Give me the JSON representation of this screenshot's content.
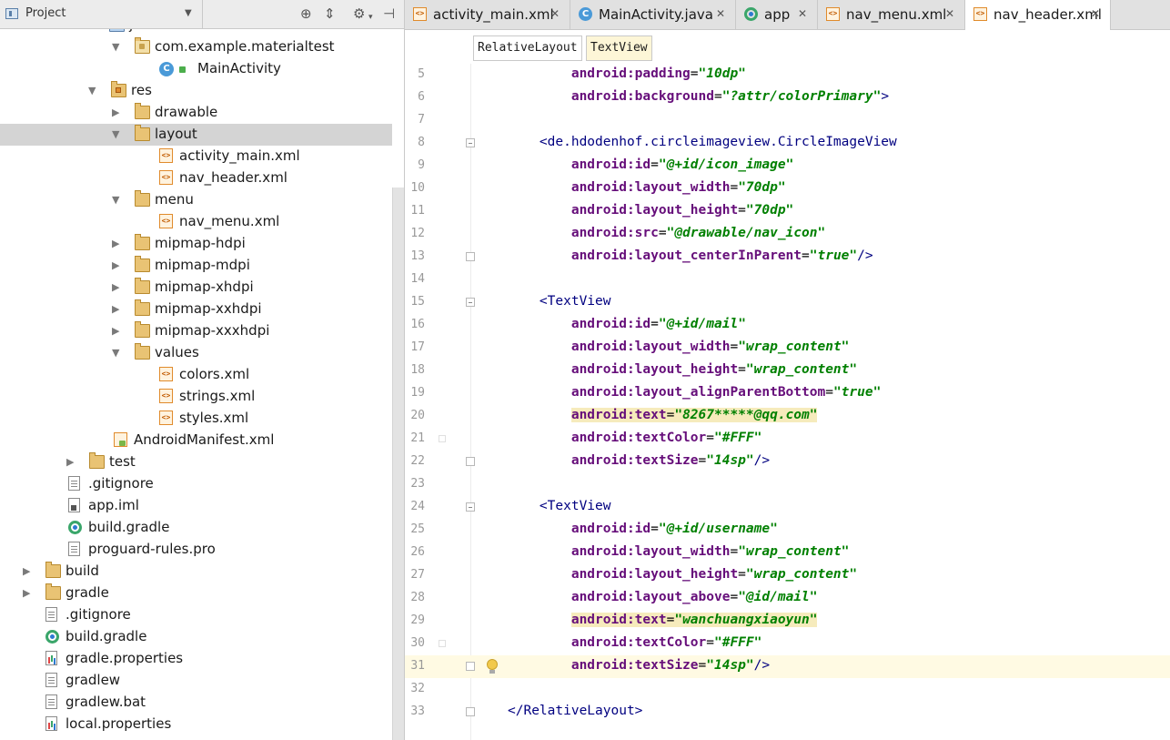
{
  "project_panel": {
    "title": "Project",
    "tools": [
      "target-icon",
      "collapse-icon",
      "gear-icon",
      "hide-icon"
    ],
    "tree": [
      {
        "label": "java",
        "icon": "folder-src",
        "indent": 120,
        "arrow": "none"
      },
      {
        "label": "com.example.materialtest",
        "icon": "folder-package",
        "indent": 148,
        "arrow": "down"
      },
      {
        "label": "MainActivity",
        "icon": "class",
        "indent": 175,
        "arrow": "none",
        "badge": true
      },
      {
        "label": "res",
        "icon": "folder-res",
        "indent": 122,
        "arrow": "down"
      },
      {
        "label": "drawable",
        "icon": "folder",
        "indent": 148,
        "arrow": "right"
      },
      {
        "label": "layout",
        "icon": "folder",
        "indent": 148,
        "arrow": "down",
        "selected": true
      },
      {
        "label": "activity_main.xml",
        "icon": "xml",
        "indent": 175,
        "arrow": "none"
      },
      {
        "label": "nav_header.xml",
        "icon": "xml",
        "indent": 175,
        "arrow": "none"
      },
      {
        "label": "menu",
        "icon": "folder",
        "indent": 148,
        "arrow": "down"
      },
      {
        "label": "nav_menu.xml",
        "icon": "xml",
        "indent": 175,
        "arrow": "none"
      },
      {
        "label": "mipmap-hdpi",
        "icon": "folder",
        "indent": 148,
        "arrow": "right"
      },
      {
        "label": "mipmap-mdpi",
        "icon": "folder",
        "indent": 148,
        "arrow": "right"
      },
      {
        "label": "mipmap-xhdpi",
        "icon": "folder",
        "indent": 148,
        "arrow": "right"
      },
      {
        "label": "mipmap-xxhdpi",
        "icon": "folder",
        "indent": 148,
        "arrow": "right"
      },
      {
        "label": "mipmap-xxxhdpi",
        "icon": "folder",
        "indent": 148,
        "arrow": "right"
      },
      {
        "label": "values",
        "icon": "folder",
        "indent": 148,
        "arrow": "down"
      },
      {
        "label": "colors.xml",
        "icon": "xml",
        "indent": 175,
        "arrow": "none"
      },
      {
        "label": "strings.xml",
        "icon": "xml",
        "indent": 175,
        "arrow": "none"
      },
      {
        "label": "styles.xml",
        "icon": "xml",
        "indent": 175,
        "arrow": "none"
      },
      {
        "label": "AndroidManifest.xml",
        "icon": "manifest",
        "indent": 125,
        "arrow": "none"
      },
      {
        "label": "test",
        "icon": "folder",
        "indent": 98,
        "arrow": "right"
      },
      {
        "label": ".gitignore",
        "icon": "text",
        "indent": 75,
        "arrow": "none"
      },
      {
        "label": "app.iml",
        "icon": "iml",
        "indent": 75,
        "arrow": "none"
      },
      {
        "label": "build.gradle",
        "icon": "gradle",
        "indent": 75,
        "arrow": "none"
      },
      {
        "label": "proguard-rules.pro",
        "icon": "text",
        "indent": 75,
        "arrow": "none"
      },
      {
        "label": "build",
        "icon": "folder",
        "indent": 50,
        "arrow": "right"
      },
      {
        "label": "gradle",
        "icon": "folder",
        "indent": 50,
        "arrow": "right"
      },
      {
        "label": ".gitignore",
        "icon": "text",
        "indent": 50,
        "arrow": "none"
      },
      {
        "label": "build.gradle",
        "icon": "gradle",
        "indent": 50,
        "arrow": "none"
      },
      {
        "label": "gradle.properties",
        "icon": "props",
        "indent": 50,
        "arrow": "none"
      },
      {
        "label": "gradlew",
        "icon": "text",
        "indent": 50,
        "arrow": "none"
      },
      {
        "label": "gradlew.bat",
        "icon": "text",
        "indent": 50,
        "arrow": "none"
      },
      {
        "label": "local.properties",
        "icon": "props",
        "indent": 50,
        "arrow": "none"
      }
    ]
  },
  "editor": {
    "tabs": [
      {
        "label": "activity_main.xml",
        "icon": "xml",
        "active": false
      },
      {
        "label": "MainActivity.java",
        "icon": "class",
        "active": false
      },
      {
        "label": "app",
        "icon": "gradle",
        "active": false
      },
      {
        "label": "nav_menu.xml",
        "icon": "xml",
        "active": false
      },
      {
        "label": "nav_header.xml",
        "icon": "xml",
        "active": true
      }
    ],
    "close_glyph": "✕",
    "breadcrumbs": [
      "RelativeLayout",
      "TextView"
    ],
    "current_line": 31,
    "lines": [
      {
        "n": 5,
        "parts": [
          [
            "        ",
            ""
          ],
          [
            "android:padding",
            "attr"
          ],
          [
            "=",
            ""
          ],
          [
            "\"10dp\"",
            "val"
          ]
        ]
      },
      {
        "n": 6,
        "parts": [
          [
            "        ",
            ""
          ],
          [
            "android:background",
            "attr"
          ],
          [
            "=",
            ""
          ],
          [
            "\"?attr/colorPrimary\"",
            "val"
          ],
          [
            ">",
            "tag"
          ]
        ]
      },
      {
        "n": 7,
        "parts": []
      },
      {
        "n": 8,
        "fold": "start",
        "parts": [
          [
            "    ",
            ""
          ],
          [
            "<de.hdodenhof.circleimageview.CircleImageView",
            "tag"
          ]
        ]
      },
      {
        "n": 9,
        "parts": [
          [
            "        ",
            ""
          ],
          [
            "android:id",
            "attr"
          ],
          [
            "=",
            ""
          ],
          [
            "\"@+id/icon_image\"",
            "val"
          ]
        ]
      },
      {
        "n": 10,
        "parts": [
          [
            "        ",
            ""
          ],
          [
            "android:layout_width",
            "attr"
          ],
          [
            "=",
            ""
          ],
          [
            "\"70dp\"",
            "val"
          ]
        ]
      },
      {
        "n": 11,
        "parts": [
          [
            "        ",
            ""
          ],
          [
            "android:layout_height",
            "attr"
          ],
          [
            "=",
            ""
          ],
          [
            "\"70dp\"",
            "val"
          ]
        ]
      },
      {
        "n": 12,
        "parts": [
          [
            "        ",
            ""
          ],
          [
            "android:src",
            "attr"
          ],
          [
            "=",
            ""
          ],
          [
            "\"@drawable/nav_icon\"",
            "val"
          ]
        ]
      },
      {
        "n": 13,
        "fold": "end",
        "parts": [
          [
            "        ",
            ""
          ],
          [
            "android:layout_centerInParent",
            "attr"
          ],
          [
            "=",
            ""
          ],
          [
            "\"true\"",
            "val"
          ],
          [
            "/>",
            "tag"
          ]
        ]
      },
      {
        "n": 14,
        "parts": []
      },
      {
        "n": 15,
        "fold": "start",
        "parts": [
          [
            "    ",
            ""
          ],
          [
            "<TextView",
            "tag"
          ]
        ]
      },
      {
        "n": 16,
        "parts": [
          [
            "        ",
            ""
          ],
          [
            "android:id",
            "attr"
          ],
          [
            "=",
            ""
          ],
          [
            "\"@+id/mail\"",
            "val"
          ]
        ]
      },
      {
        "n": 17,
        "parts": [
          [
            "        ",
            ""
          ],
          [
            "android:layout_width",
            "attr"
          ],
          [
            "=",
            ""
          ],
          [
            "\"wrap_content\"",
            "val"
          ]
        ]
      },
      {
        "n": 18,
        "parts": [
          [
            "        ",
            ""
          ],
          [
            "android:layout_height",
            "attr"
          ],
          [
            "=",
            ""
          ],
          [
            "\"wrap_content\"",
            "val"
          ]
        ]
      },
      {
        "n": 19,
        "parts": [
          [
            "        ",
            ""
          ],
          [
            "android:layout_alignParentBottom",
            "attr"
          ],
          [
            "=",
            ""
          ],
          [
            "\"true\"",
            "val"
          ]
        ]
      },
      {
        "n": 20,
        "hl": true,
        "parts": [
          [
            "        ",
            ""
          ],
          [
            "android:text",
            "attr"
          ],
          [
            "=",
            ""
          ],
          [
            "\"8267*****@qq.com\"",
            "val"
          ]
        ]
      },
      {
        "n": 21,
        "mark": true,
        "parts": [
          [
            "        ",
            ""
          ],
          [
            "android:textColor",
            "attr"
          ],
          [
            "=",
            ""
          ],
          [
            "\"#FFF\"",
            "val"
          ]
        ]
      },
      {
        "n": 22,
        "fold": "end",
        "parts": [
          [
            "        ",
            ""
          ],
          [
            "android:textSize",
            "attr"
          ],
          [
            "=",
            ""
          ],
          [
            "\"14sp\"",
            "val"
          ],
          [
            "/>",
            "tag"
          ]
        ]
      },
      {
        "n": 23,
        "parts": []
      },
      {
        "n": 24,
        "fold": "start",
        "parts": [
          [
            "    ",
            ""
          ],
          [
            "<TextView",
            "tag"
          ]
        ]
      },
      {
        "n": 25,
        "parts": [
          [
            "        ",
            ""
          ],
          [
            "android:id",
            "attr"
          ],
          [
            "=",
            ""
          ],
          [
            "\"@+id/username\"",
            "val"
          ]
        ]
      },
      {
        "n": 26,
        "parts": [
          [
            "        ",
            ""
          ],
          [
            "android:layout_width",
            "attr"
          ],
          [
            "=",
            ""
          ],
          [
            "\"wrap_content\"",
            "val"
          ]
        ]
      },
      {
        "n": 27,
        "parts": [
          [
            "        ",
            ""
          ],
          [
            "android:layout_height",
            "attr"
          ],
          [
            "=",
            ""
          ],
          [
            "\"wrap_content\"",
            "val"
          ]
        ]
      },
      {
        "n": 28,
        "parts": [
          [
            "        ",
            ""
          ],
          [
            "android:layout_above",
            "attr"
          ],
          [
            "=",
            ""
          ],
          [
            "\"@id/mail\"",
            "val"
          ]
        ]
      },
      {
        "n": 29,
        "hl": true,
        "parts": [
          [
            "        ",
            ""
          ],
          [
            "android:text",
            "attr"
          ],
          [
            "=",
            ""
          ],
          [
            "\"wanchuangxiaoyun\"",
            "val"
          ]
        ]
      },
      {
        "n": 30,
        "mark": true,
        "parts": [
          [
            "        ",
            ""
          ],
          [
            "android:textColor",
            "attr"
          ],
          [
            "=",
            ""
          ],
          [
            "\"#FFF\"",
            "val"
          ]
        ]
      },
      {
        "n": 31,
        "fold": "end",
        "bulb": true,
        "parts": [
          [
            "        ",
            ""
          ],
          [
            "android:textSize",
            "attr"
          ],
          [
            "=",
            ""
          ],
          [
            "\"14sp\"",
            "val"
          ],
          [
            "/>",
            "tag"
          ]
        ]
      },
      {
        "n": 32,
        "parts": []
      },
      {
        "n": 33,
        "fold": "end",
        "parts": [
          [
            "</RelativeLayout>",
            "tag"
          ]
        ]
      }
    ]
  },
  "colors": {
    "tag": "#000080",
    "attr": "#660e7a",
    "value": "#008000",
    "current_line": "#fffae3",
    "selection": "#d4d4d4"
  }
}
